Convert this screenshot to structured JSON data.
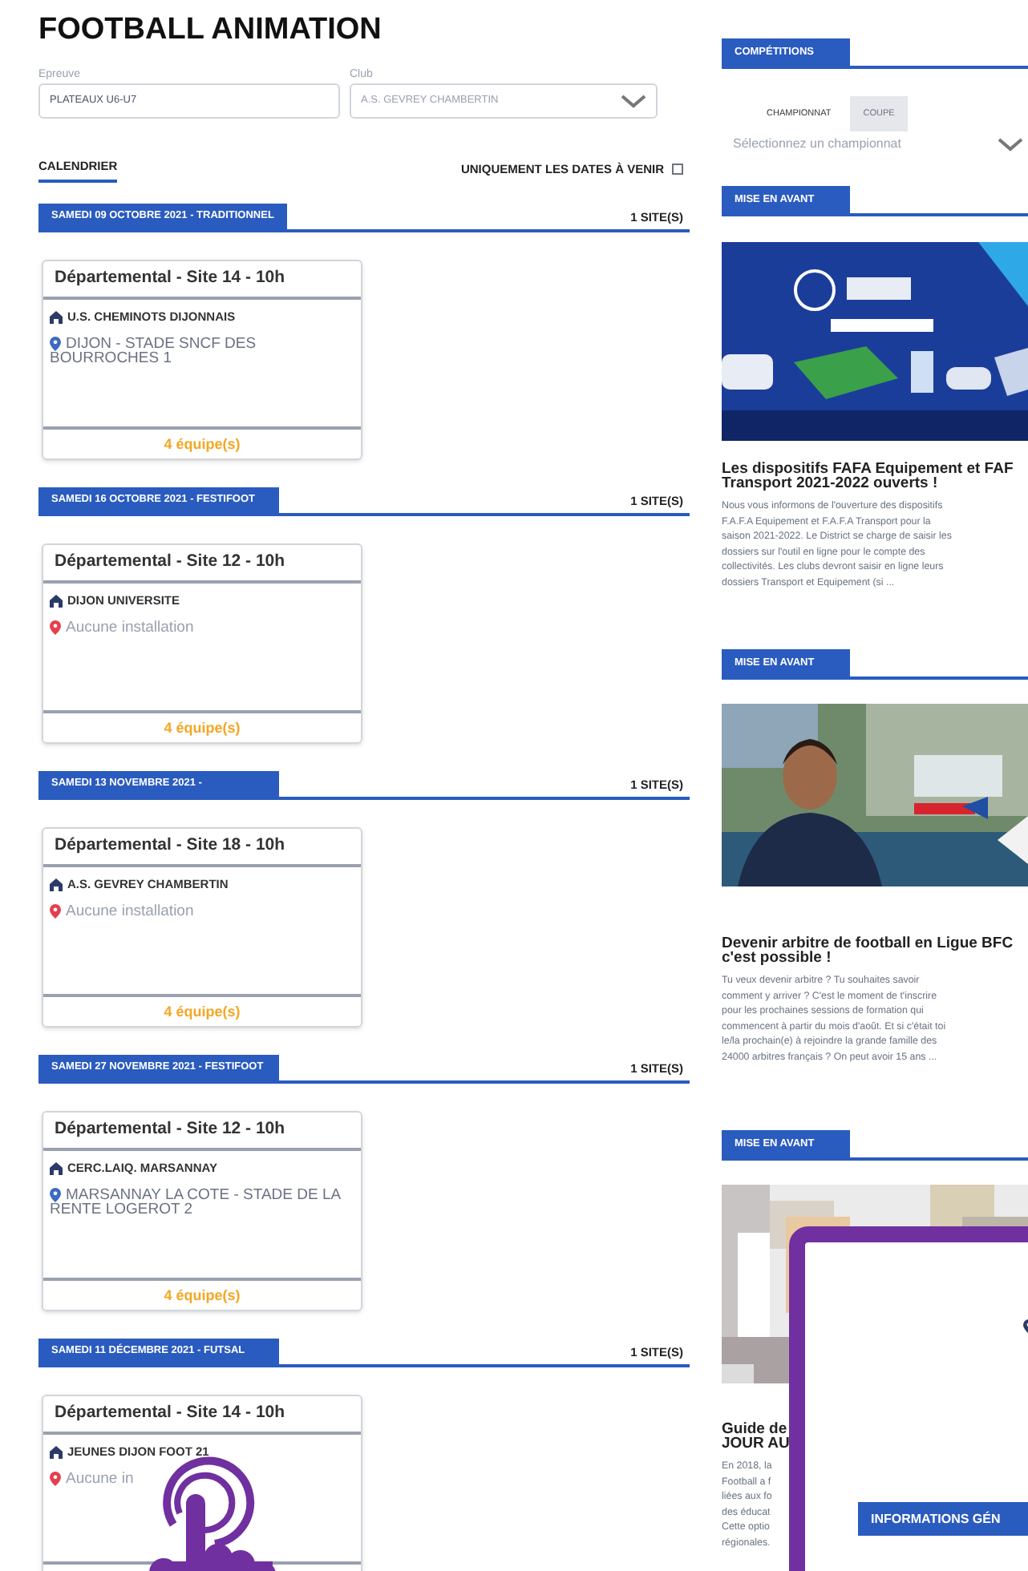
{
  "title": "FOOTBALL ANIMATION",
  "filters": [
    {
      "label": "Epreuve",
      "value": "PLATEAUX U6-U7",
      "kind": "text"
    },
    {
      "label": "Club",
      "value": "A.S. GEVREY CHAMBERTIN",
      "kind": "select"
    }
  ],
  "calendar_tab": {
    "label": "CALENDRIER",
    "selected": true
  },
  "upcoming_only": {
    "label": "UNIQUEMENT LES DATES À VENIR",
    "checked": false
  },
  "dates": [
    {
      "title": "SAMEDI 09 OCTOBRE 2021 - TRADITIONNEL",
      "sites": "1 SITE(S)",
      "card": {
        "header": "Départemental - Site 14 - 10h",
        "club": "U.S. CHEMINOTS DIJONNAIS",
        "location": "DIJON - STADE SNCF DES BOURROCHES 1",
        "location_known": true,
        "teams": "4 équipe(s)"
      }
    },
    {
      "title": "SAMEDI 16 OCTOBRE 2021 - FESTIFOOT",
      "sites": "1 SITE(S)",
      "card": {
        "header": "Départemental - Site 12 - 10h",
        "club": "DIJON UNIVERSITE",
        "location": "Aucune installation",
        "location_known": false,
        "teams": "4 équipe(s)"
      }
    },
    {
      "title": "SAMEDI 13 NOVEMBRE 2021 -",
      "sites": "1 SITE(S)",
      "card": {
        "header": "Départemental - Site 18 - 10h",
        "club": "A.S. GEVREY CHAMBERTIN",
        "location": "Aucune installation",
        "location_known": false,
        "teams": "4 équipe(s)"
      }
    },
    {
      "title": "SAMEDI 27 NOVEMBRE 2021 - FESTIFOOT",
      "sites": "1 SITE(S)",
      "card": {
        "header": "Départemental - Site 12 - 10h",
        "club": "CERC.LAIQ. MARSANNAY",
        "location": "MARSANNAY LA COTE - STADE DE LA RENTE LOGEROT 2",
        "location_known": true,
        "teams": "4 équipe(s)"
      }
    },
    {
      "title": "SAMEDI 11 DÉCEMBRE 2021 - FUTSAL",
      "sites": "1 SITE(S)",
      "card": {
        "header": "Départemental - Site 14 - 10h",
        "club": "JEUNES DIJON FOOT 21",
        "location": "Aucune in",
        "location_known": false
      }
    }
  ],
  "competitions": {
    "title": "COMPÉTITIONS",
    "tabs": [
      {
        "label": "CHAMPIONNAT",
        "selected": true
      },
      {
        "label": "COUPE",
        "selected": false
      }
    ],
    "placeholder": "Sélectionnez un championnat"
  },
  "featured": [
    {
      "section": "MISE EN AVANT",
      "title_lines": [
        "Les dispositifs FAFA Equipement et FAF",
        "Transport 2021-2022 ouverts !"
      ],
      "text_lines": [
        " Nous vous informons de l'ouverture des dispositifs",
        "F.A.F.A Equipement et F.A.F.A Transport pour la",
        "saison 2021-2022. Le District se charge de saisir les",
        "dossiers sur l'outil en ligne pour le compte des",
        "collectivités. Les clubs devront saisir en ligne leurs",
        "dossiers Transport et Equipement (si ..."
      ]
    },
    {
      "section": "MISE EN AVANT",
      "title_lines": [
        "Devenir arbitre de football en Ligue BFC",
        "c'est possible !"
      ],
      "text_lines": [
        "Tu veux devenir arbitre ? Tu souhaites savoir",
        "comment y arriver ? C'est le moment de t'inscrire",
        "pour les prochaines sessions de formation qui",
        "commencent à partir du mois d'août. Et si c'était toi",
        "le/la prochain(e) à rejoindre la grande famille des",
        "24000 arbitres français ? On peut avoir 15 ans ..."
      ]
    },
    {
      "section": "MISE EN AVANT",
      "title_lines": [
        "Guide de",
        "JOUR AU"
      ],
      "text_lines": [
        "En 2018, la",
        "Football a f",
        "liées aux fo",
        "des éducat",
        "Cette optio",
        "régionales."
      ]
    }
  ],
  "popup": {
    "button": "INFORMATIONS GÉN"
  }
}
